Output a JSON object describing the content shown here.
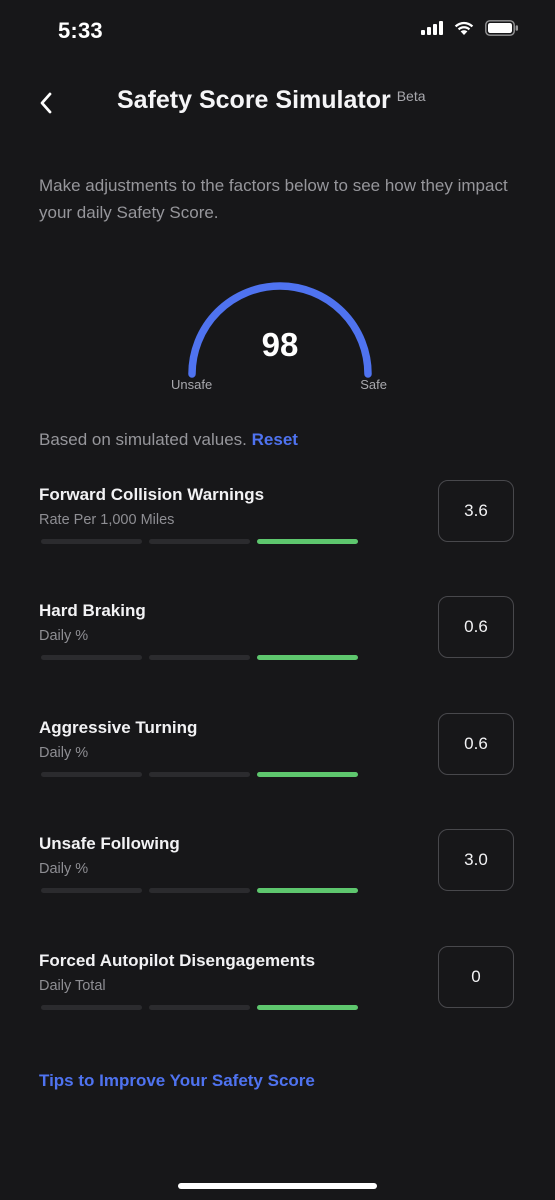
{
  "status_bar": {
    "time": "5:33"
  },
  "header": {
    "title": "Safety Score Simulator",
    "badge": "Beta"
  },
  "description": "Make adjustments to the factors below to see how they impact your daily Safety Score.",
  "gauge": {
    "score": "98",
    "min_label": "Unsafe",
    "max_label": "Safe",
    "color": "#4f73f0"
  },
  "simulation": {
    "note": "Based on simulated values.",
    "reset_label": "Reset"
  },
  "factors": [
    {
      "name": "Forward Collision Warnings",
      "unit": "Rate Per 1,000 Miles",
      "value": "3.6",
      "level": 3
    },
    {
      "name": "Hard Braking",
      "unit": "Daily %",
      "value": "0.6",
      "level": 3
    },
    {
      "name": "Aggressive Turning",
      "unit": "Daily %",
      "value": "0.6",
      "level": 3
    },
    {
      "name": "Unsafe Following",
      "unit": "Daily %",
      "value": "3.0",
      "level": 3
    },
    {
      "name": "Forced Autopilot Disengagements",
      "unit": "Daily Total",
      "value": "0",
      "level": 3
    }
  ],
  "tips_link": "Tips to Improve Your Safety Score",
  "colors": {
    "accent": "#4f73f0",
    "good": "#5ec76e",
    "background": "#171719"
  }
}
